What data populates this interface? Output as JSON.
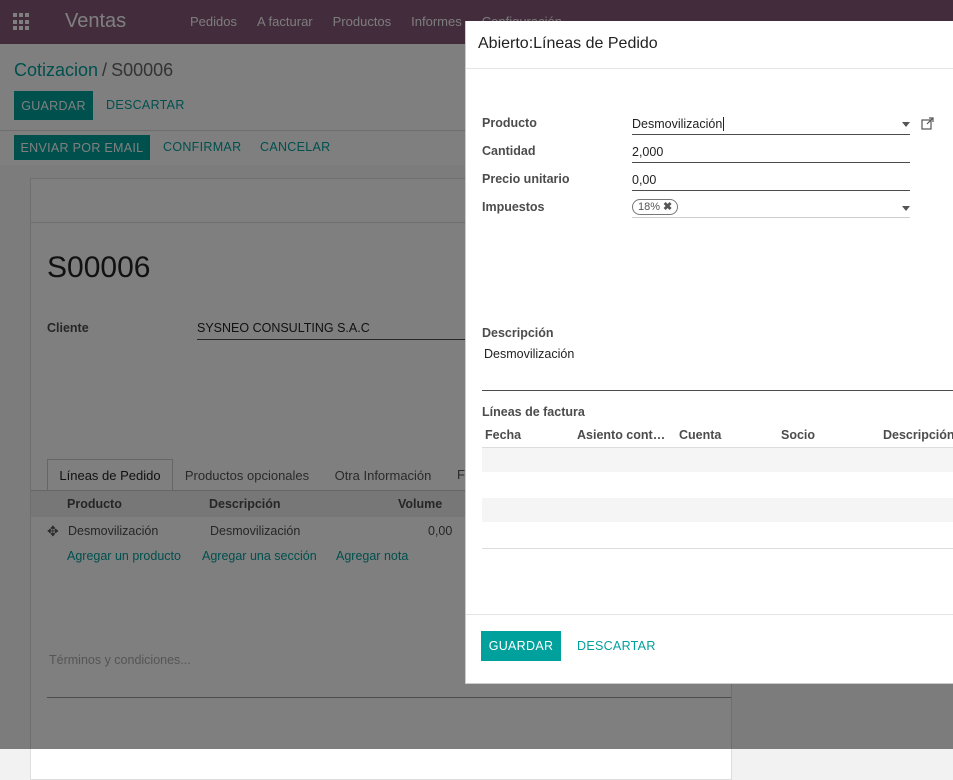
{
  "topbar": {
    "brand": "Ventas",
    "menu": [
      "Pedidos",
      "A facturar",
      "Productos",
      "Informes",
      "Configuración"
    ]
  },
  "breadcrumb": {
    "parent": "Cotizacion",
    "separator": "/",
    "current": "S00006"
  },
  "form_buttons": {
    "save": "GUARDAR",
    "discard": "DESCARTAR"
  },
  "status_buttons": {
    "email": "ENVIAR POR EMAIL",
    "confirm": "CONFIRMAR",
    "cancel": "CANCELAR"
  },
  "record": {
    "name": "S00006",
    "customer_label": "Cliente",
    "customer_value": "SYSNEO CONSULTING S.A.C"
  },
  "tabs": [
    "Líneas de Pedido",
    "Productos opcionales",
    "Otra Información",
    "Fi"
  ],
  "order_lines": {
    "headers": [
      "Producto",
      "Descripción",
      "Volume"
    ],
    "rows": [
      {
        "product": "Desmovilización",
        "description": "Desmovilización",
        "volume": "0,00"
      }
    ],
    "actions": [
      "Agregar un producto",
      "Agregar una sección",
      "Agregar nota"
    ]
  },
  "terms_placeholder": "Términos y condiciones...",
  "dialog": {
    "title": "Abierto:Líneas de Pedido",
    "fields": {
      "product_label": "Producto",
      "product_value": "Desmovilización",
      "qty_label": "Cantidad",
      "qty_value": "2,000",
      "price_label": "Precio unitario",
      "price_value": "0,00",
      "tax_label": "Impuestos",
      "tax_tag": "18%"
    },
    "description_label": "Descripción",
    "description_value": "Desmovilización",
    "invoice_lines_label": "Líneas de factura",
    "invoice_headers": [
      "Fecha",
      "Asiento cont…",
      "Cuenta",
      "Socio",
      "Descripción"
    ],
    "save": "GUARDAR",
    "discard": "DESCARTAR"
  },
  "colors": {
    "brand": "#875a7b",
    "accent": "#00a09d"
  }
}
